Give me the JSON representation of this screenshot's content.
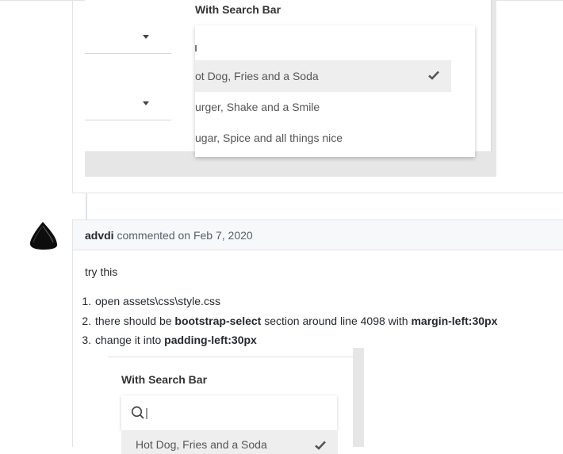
{
  "comment1": {
    "dropdown": {
      "label": "With Search Bar",
      "options": [
        "ot Dog, Fries and a Soda",
        "urger, Shake and a Smile",
        "ugar, Spice and all things nice"
      ],
      "selected_index": 0
    }
  },
  "comment2": {
    "author": "advdi",
    "meta": "commented on Feb 7, 2020",
    "intro": "try this",
    "steps": [
      {
        "num": "1.",
        "pre": "open assets\\css\\style.css",
        "b1": "",
        "mid": "",
        "b2": ""
      },
      {
        "num": "2.",
        "pre": "there should be ",
        "b1": "bootstrap-select",
        "mid": " section around line 4098 with ",
        "b2": "margin-left:30px"
      },
      {
        "num": "3.",
        "pre": "change it into ",
        "b1": "padding-left:30px",
        "mid": "",
        "b2": ""
      }
    ],
    "screenshot": {
      "label": "With Search Bar",
      "option": "Hot Dog, Fries and a Soda"
    }
  }
}
